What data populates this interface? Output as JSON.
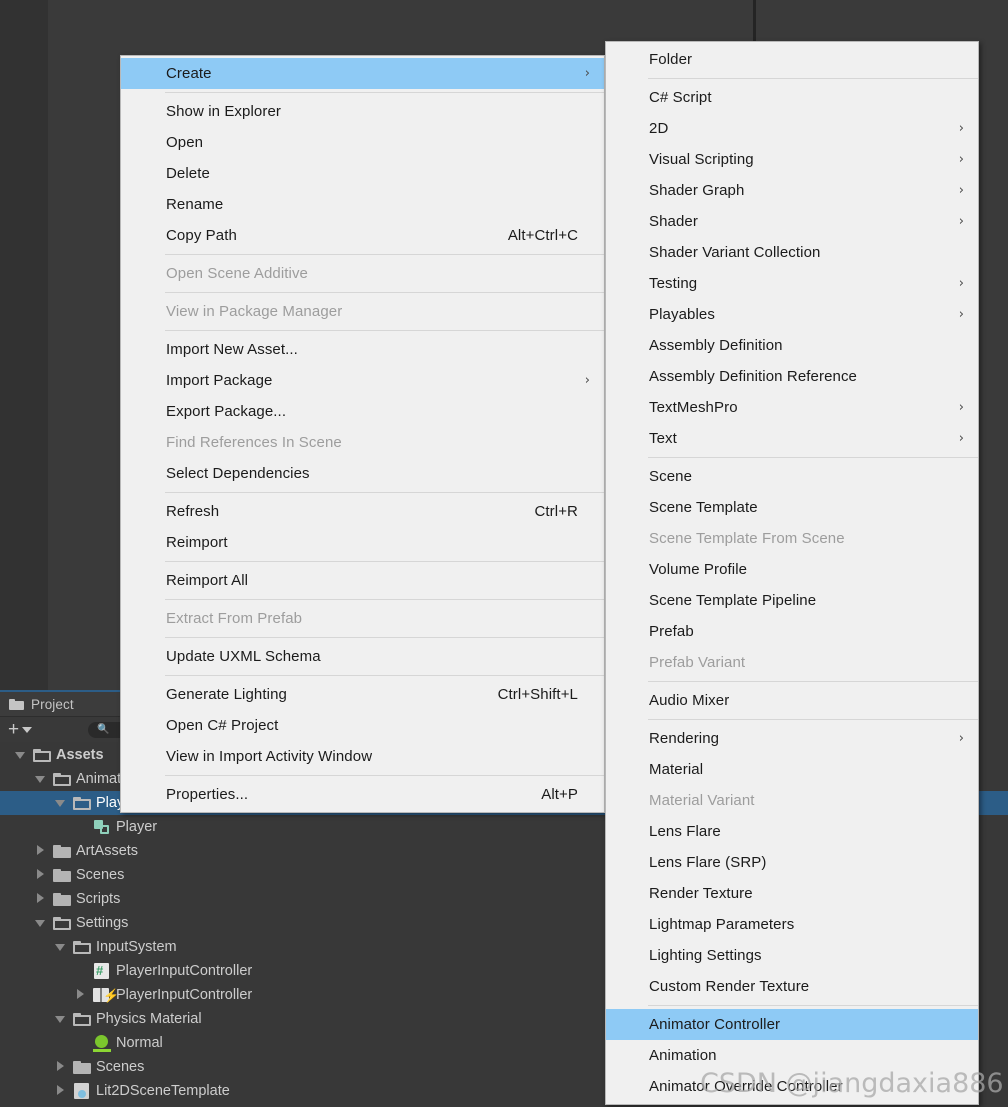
{
  "theme": {
    "editor_bg": "#383838",
    "panel_bg": "#3a3a3a",
    "menu_bg": "#f0f0f0",
    "menu_highlight": "#8ecaf5",
    "tree_selected": "#2c5d87",
    "tab_accent": "#2c5d87"
  },
  "project_panel": {
    "tab_label": "Project",
    "tab_icon": "folder-icon",
    "add_button_label": "+",
    "search_placeholder": "",
    "tree": [
      {
        "label": "Assets",
        "depth": 0,
        "twisty": "open",
        "icon": "folder-open-icon",
        "selected": false,
        "bold": true
      },
      {
        "label": "Animations",
        "depth": 1,
        "twisty": "open",
        "icon": "folder-open-icon",
        "selected": false,
        "bold": false
      },
      {
        "label": "Player",
        "depth": 2,
        "twisty": "open",
        "icon": "folder-open-icon",
        "selected": true,
        "bold": false
      },
      {
        "label": "Player",
        "depth": 3,
        "twisty": "none",
        "icon": "prefab-icon",
        "selected": false,
        "bold": false
      },
      {
        "label": "ArtAssets",
        "depth": 1,
        "twisty": "closed",
        "icon": "folder-icon",
        "selected": false,
        "bold": false
      },
      {
        "label": "Scenes",
        "depth": 1,
        "twisty": "closed",
        "icon": "folder-icon",
        "selected": false,
        "bold": false
      },
      {
        "label": "Scripts",
        "depth": 1,
        "twisty": "closed",
        "icon": "folder-icon",
        "selected": false,
        "bold": false
      },
      {
        "label": "Settings",
        "depth": 1,
        "twisty": "open",
        "icon": "folder-open-icon",
        "selected": false,
        "bold": false
      },
      {
        "label": "InputSystem",
        "depth": 2,
        "twisty": "open",
        "icon": "folder-open-icon",
        "selected": false,
        "bold": false
      },
      {
        "label": "PlayerInputController",
        "depth": 3,
        "twisty": "none",
        "icon": "csharp-script-icon",
        "selected": false,
        "bold": false
      },
      {
        "label": "PlayerInputController",
        "depth": 3,
        "twisty": "closed",
        "icon": "input-actions-icon",
        "selected": false,
        "bold": false
      },
      {
        "label": "Physics Material",
        "depth": 2,
        "twisty": "open",
        "icon": "folder-open-icon",
        "selected": false,
        "bold": false
      },
      {
        "label": "Normal",
        "depth": 3,
        "twisty": "none",
        "icon": "physics-material-icon",
        "selected": false,
        "bold": false
      },
      {
        "label": "Scenes",
        "depth": 2,
        "twisty": "closed",
        "icon": "folder-icon",
        "selected": false,
        "bold": false
      },
      {
        "label": "Lit2DSceneTemplate",
        "depth": 2,
        "twisty": "closed",
        "icon": "scene-template-icon",
        "selected": false,
        "bold": false
      }
    ]
  },
  "context_menu": {
    "items": [
      {
        "type": "item",
        "label": "Create",
        "shortcut": "",
        "submenu": true,
        "disabled": false,
        "highlight": true
      },
      {
        "type": "sep"
      },
      {
        "type": "item",
        "label": "Show in Explorer",
        "shortcut": "",
        "submenu": false,
        "disabled": false,
        "highlight": false
      },
      {
        "type": "item",
        "label": "Open",
        "shortcut": "",
        "submenu": false,
        "disabled": false,
        "highlight": false
      },
      {
        "type": "item",
        "label": "Delete",
        "shortcut": "",
        "submenu": false,
        "disabled": false,
        "highlight": false
      },
      {
        "type": "item",
        "label": "Rename",
        "shortcut": "",
        "submenu": false,
        "disabled": false,
        "highlight": false
      },
      {
        "type": "item",
        "label": "Copy Path",
        "shortcut": "Alt+Ctrl+C",
        "submenu": false,
        "disabled": false,
        "highlight": false
      },
      {
        "type": "sep"
      },
      {
        "type": "item",
        "label": "Open Scene Additive",
        "shortcut": "",
        "submenu": false,
        "disabled": true,
        "highlight": false
      },
      {
        "type": "sep"
      },
      {
        "type": "item",
        "label": "View in Package Manager",
        "shortcut": "",
        "submenu": false,
        "disabled": true,
        "highlight": false
      },
      {
        "type": "sep"
      },
      {
        "type": "item",
        "label": "Import New Asset...",
        "shortcut": "",
        "submenu": false,
        "disabled": false,
        "highlight": false
      },
      {
        "type": "item",
        "label": "Import Package",
        "shortcut": "",
        "submenu": true,
        "disabled": false,
        "highlight": false
      },
      {
        "type": "item",
        "label": "Export Package...",
        "shortcut": "",
        "submenu": false,
        "disabled": false,
        "highlight": false
      },
      {
        "type": "item",
        "label": "Find References In Scene",
        "shortcut": "",
        "submenu": false,
        "disabled": true,
        "highlight": false
      },
      {
        "type": "item",
        "label": "Select Dependencies",
        "shortcut": "",
        "submenu": false,
        "disabled": false,
        "highlight": false
      },
      {
        "type": "sep"
      },
      {
        "type": "item",
        "label": "Refresh",
        "shortcut": "Ctrl+R",
        "submenu": false,
        "disabled": false,
        "highlight": false
      },
      {
        "type": "item",
        "label": "Reimport",
        "shortcut": "",
        "submenu": false,
        "disabled": false,
        "highlight": false
      },
      {
        "type": "sep"
      },
      {
        "type": "item",
        "label": "Reimport All",
        "shortcut": "",
        "submenu": false,
        "disabled": false,
        "highlight": false
      },
      {
        "type": "sep"
      },
      {
        "type": "item",
        "label": "Extract From Prefab",
        "shortcut": "",
        "submenu": false,
        "disabled": true,
        "highlight": false
      },
      {
        "type": "sep"
      },
      {
        "type": "item",
        "label": "Update UXML Schema",
        "shortcut": "",
        "submenu": false,
        "disabled": false,
        "highlight": false
      },
      {
        "type": "sep"
      },
      {
        "type": "item",
        "label": "Generate Lighting",
        "shortcut": "Ctrl+Shift+L",
        "submenu": false,
        "disabled": false,
        "highlight": false
      },
      {
        "type": "item",
        "label": "Open C# Project",
        "shortcut": "",
        "submenu": false,
        "disabled": false,
        "highlight": false
      },
      {
        "type": "item",
        "label": "View in Import Activity Window",
        "shortcut": "",
        "submenu": false,
        "disabled": false,
        "highlight": false
      },
      {
        "type": "sep"
      },
      {
        "type": "item",
        "label": "Properties...",
        "shortcut": "Alt+P",
        "submenu": false,
        "disabled": false,
        "highlight": false
      }
    ]
  },
  "create_menu": {
    "items": [
      {
        "type": "item",
        "label": "Folder",
        "submenu": false,
        "disabled": false,
        "highlight": false
      },
      {
        "type": "sep"
      },
      {
        "type": "item",
        "label": "C# Script",
        "submenu": false,
        "disabled": false,
        "highlight": false
      },
      {
        "type": "item",
        "label": "2D",
        "submenu": true,
        "disabled": false,
        "highlight": false
      },
      {
        "type": "item",
        "label": "Visual Scripting",
        "submenu": true,
        "disabled": false,
        "highlight": false
      },
      {
        "type": "item",
        "label": "Shader Graph",
        "submenu": true,
        "disabled": false,
        "highlight": false
      },
      {
        "type": "item",
        "label": "Shader",
        "submenu": true,
        "disabled": false,
        "highlight": false
      },
      {
        "type": "item",
        "label": "Shader Variant Collection",
        "submenu": false,
        "disabled": false,
        "highlight": false
      },
      {
        "type": "item",
        "label": "Testing",
        "submenu": true,
        "disabled": false,
        "highlight": false
      },
      {
        "type": "item",
        "label": "Playables",
        "submenu": true,
        "disabled": false,
        "highlight": false
      },
      {
        "type": "item",
        "label": "Assembly Definition",
        "submenu": false,
        "disabled": false,
        "highlight": false
      },
      {
        "type": "item",
        "label": "Assembly Definition Reference",
        "submenu": false,
        "disabled": false,
        "highlight": false
      },
      {
        "type": "item",
        "label": "TextMeshPro",
        "submenu": true,
        "disabled": false,
        "highlight": false
      },
      {
        "type": "item",
        "label": "Text",
        "submenu": true,
        "disabled": false,
        "highlight": false
      },
      {
        "type": "sep"
      },
      {
        "type": "item",
        "label": "Scene",
        "submenu": false,
        "disabled": false,
        "highlight": false
      },
      {
        "type": "item",
        "label": "Scene Template",
        "submenu": false,
        "disabled": false,
        "highlight": false
      },
      {
        "type": "item",
        "label": "Scene Template From Scene",
        "submenu": false,
        "disabled": true,
        "highlight": false
      },
      {
        "type": "item",
        "label": "Volume Profile",
        "submenu": false,
        "disabled": false,
        "highlight": false
      },
      {
        "type": "item",
        "label": "Scene Template Pipeline",
        "submenu": false,
        "disabled": false,
        "highlight": false
      },
      {
        "type": "item",
        "label": "Prefab",
        "submenu": false,
        "disabled": false,
        "highlight": false
      },
      {
        "type": "item",
        "label": "Prefab Variant",
        "submenu": false,
        "disabled": true,
        "highlight": false
      },
      {
        "type": "sep"
      },
      {
        "type": "item",
        "label": "Audio Mixer",
        "submenu": false,
        "disabled": false,
        "highlight": false
      },
      {
        "type": "sep"
      },
      {
        "type": "item",
        "label": "Rendering",
        "submenu": true,
        "disabled": false,
        "highlight": false
      },
      {
        "type": "item",
        "label": "Material",
        "submenu": false,
        "disabled": false,
        "highlight": false
      },
      {
        "type": "item",
        "label": "Material Variant",
        "submenu": false,
        "disabled": true,
        "highlight": false
      },
      {
        "type": "item",
        "label": "Lens Flare",
        "submenu": false,
        "disabled": false,
        "highlight": false
      },
      {
        "type": "item",
        "label": "Lens Flare (SRP)",
        "submenu": false,
        "disabled": false,
        "highlight": false
      },
      {
        "type": "item",
        "label": "Render Texture",
        "submenu": false,
        "disabled": false,
        "highlight": false
      },
      {
        "type": "item",
        "label": "Lightmap Parameters",
        "submenu": false,
        "disabled": false,
        "highlight": false
      },
      {
        "type": "item",
        "label": "Lighting Settings",
        "submenu": false,
        "disabled": false,
        "highlight": false
      },
      {
        "type": "item",
        "label": "Custom Render Texture",
        "submenu": false,
        "disabled": false,
        "highlight": false
      },
      {
        "type": "sep"
      },
      {
        "type": "item",
        "label": "Animator Controller",
        "submenu": false,
        "disabled": false,
        "highlight": true
      },
      {
        "type": "item",
        "label": "Animation",
        "submenu": false,
        "disabled": false,
        "highlight": false
      },
      {
        "type": "item",
        "label": "Animator Override Controller",
        "submenu": false,
        "disabled": false,
        "highlight": false
      }
    ]
  },
  "watermark": {
    "text": "CSDN @jiangdaxia886"
  }
}
